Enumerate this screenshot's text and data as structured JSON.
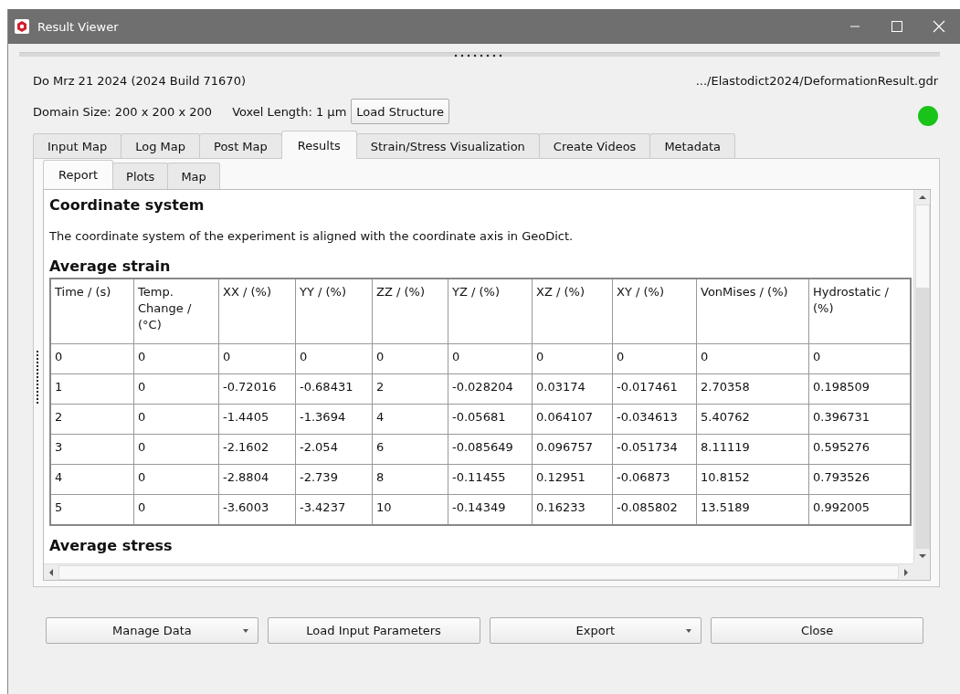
{
  "window": {
    "title": "Result Viewer"
  },
  "info": {
    "date": "Do Mrz 21 2024 (2024 Build 71670)",
    "path": ".../Elastodict2024/DeformationResult.gdr",
    "domain_size": "Domain Size: 200 x 200 x 200",
    "voxel_length": "Voxel Length: 1 µm",
    "load_button": "Load Structure"
  },
  "tabs": [
    {
      "label": "Input Map",
      "selected": false
    },
    {
      "label": "Log Map",
      "selected": false
    },
    {
      "label": "Post Map",
      "selected": false
    },
    {
      "label": "Results",
      "selected": true
    },
    {
      "label": "Strain/Stress Visualization",
      "selected": false
    },
    {
      "label": "Create Videos",
      "selected": false
    },
    {
      "label": "Metadata",
      "selected": false
    }
  ],
  "subtabs": [
    {
      "label": "Report",
      "selected": true
    },
    {
      "label": "Plots",
      "selected": false
    },
    {
      "label": "Map",
      "selected": false
    }
  ],
  "report": [
    {
      "kind": "heading",
      "text": "Coordinate system"
    },
    {
      "kind": "paragraph",
      "text": "The coordinate system of the experiment is aligned with the coordinate axis in GeoDict."
    },
    {
      "kind": "heading",
      "text": "Average strain"
    },
    {
      "kind": "table",
      "columns": [
        "Time / (s)",
        "Temp. Change / (°C)",
        "XX / (%)",
        "YY / (%)",
        "ZZ / (%)",
        "YZ / (%)",
        "XZ / (%)",
        "XY / (%)",
        "VonMises / (%)",
        "Hydrostatic / (%)"
      ],
      "rows": [
        [
          "0",
          "0",
          "0",
          "0",
          "0",
          "0",
          "0",
          "0",
          "0",
          "0"
        ],
        [
          "1",
          "0",
          "-0.72016",
          "-0.68431",
          "2",
          "-0.028204",
          "0.03174",
          "-0.017461",
          "2.70358",
          "0.198509"
        ],
        [
          "2",
          "0",
          "-1.4405",
          "-1.3694",
          "4",
          "-0.05681",
          "0.064107",
          "-0.034613",
          "5.40762",
          "0.396731"
        ],
        [
          "3",
          "0",
          "-2.1602",
          "-2.054",
          "6",
          "-0.085649",
          "0.096757",
          "-0.051734",
          "8.11119",
          "0.595276"
        ],
        [
          "4",
          "0",
          "-2.8804",
          "-2.739",
          "8",
          "-0.11455",
          "0.12951",
          "-0.06873",
          "10.8152",
          "0.793526"
        ],
        [
          "5",
          "0",
          "-3.6003",
          "-3.4237",
          "10",
          "-0.14349",
          "0.16233",
          "-0.085802",
          "13.5189",
          "0.992005"
        ]
      ]
    },
    {
      "kind": "heading",
      "text": "Average stress"
    }
  ],
  "buttons": [
    {
      "label": "Manage Data",
      "has_menu": true
    },
    {
      "label": "Load Input Parameters",
      "has_menu": false
    },
    {
      "label": "Export",
      "has_menu": true
    },
    {
      "label": "Close",
      "has_menu": false
    }
  ]
}
